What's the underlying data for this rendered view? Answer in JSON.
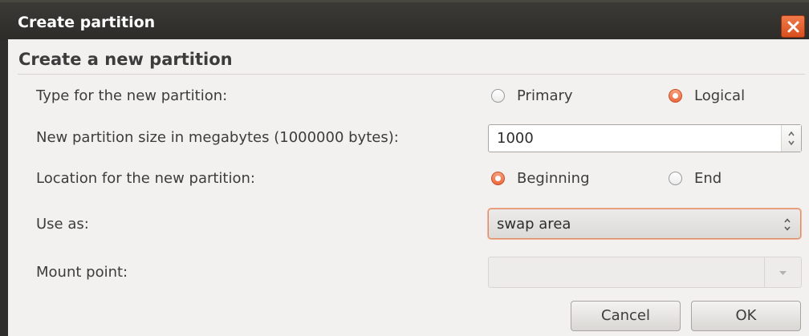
{
  "window": {
    "title": "Create partition"
  },
  "dialog": {
    "heading": "Create a new partition",
    "type": {
      "label": "Type for the new partition:",
      "options": [
        "Primary",
        "Logical"
      ],
      "selected": "Logical"
    },
    "size": {
      "label": "New partition size in megabytes (1000000 bytes):",
      "value": "1000"
    },
    "location": {
      "label": "Location for the new partition:",
      "options": [
        "Beginning",
        "End"
      ],
      "selected": "Beginning"
    },
    "use_as": {
      "label": "Use as:",
      "value": "swap area"
    },
    "mount_point": {
      "label": "Mount point:",
      "value": ""
    },
    "buttons": {
      "cancel": "Cancel",
      "ok": "OK"
    }
  },
  "colors": {
    "accent": "#ec6a3e",
    "titlebar": "#3b3a36",
    "close": "#e0552a"
  }
}
